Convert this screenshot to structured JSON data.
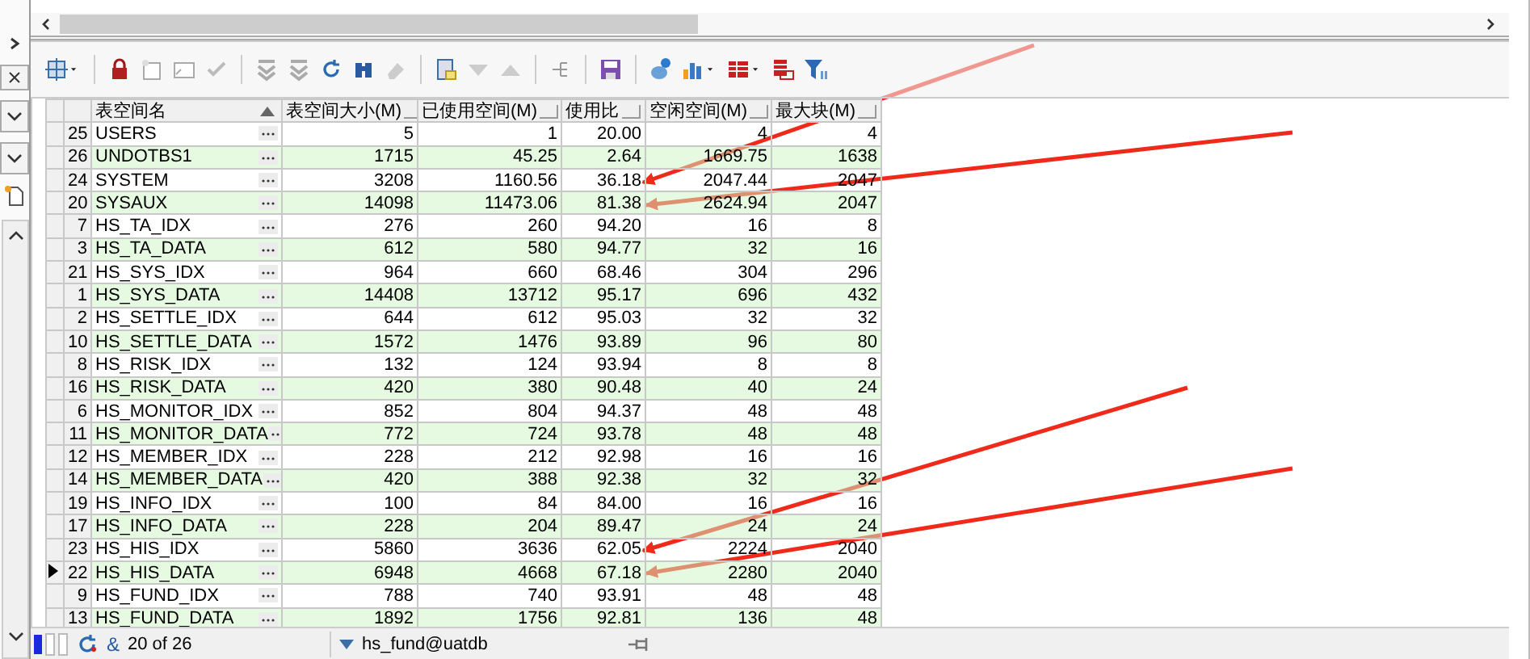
{
  "grid": {
    "columns": [
      {
        "label": "表空间名",
        "sorted": true
      },
      {
        "label": "表空间大小(M)",
        "sorted": false
      },
      {
        "label": "已使用空间(M)",
        "sorted": false
      },
      {
        "label": "使用比",
        "sorted": false
      },
      {
        "label": "空闲空间(M)",
        "sorted": false
      },
      {
        "label": "最大块(M)",
        "sorted": false
      }
    ],
    "rows": [
      {
        "num": "25",
        "cells": [
          "USERS",
          "5",
          "1",
          "20.00",
          "4",
          "4"
        ],
        "selected": false
      },
      {
        "num": "26",
        "cells": [
          "UNDOTBS1",
          "1715",
          "45.25",
          "2.64",
          "1669.75",
          "1638"
        ],
        "selected": false
      },
      {
        "num": "24",
        "cells": [
          "SYSTEM",
          "3208",
          "1160.56",
          "36.18",
          "2047.44",
          "2047"
        ],
        "selected": false
      },
      {
        "num": "20",
        "cells": [
          "SYSAUX",
          "14098",
          "11473.06",
          "81.38",
          "2624.94",
          "2047"
        ],
        "selected": false
      },
      {
        "num": "7",
        "cells": [
          "HS_TA_IDX",
          "276",
          "260",
          "94.20",
          "16",
          "8"
        ],
        "selected": false
      },
      {
        "num": "3",
        "cells": [
          "HS_TA_DATA",
          "612",
          "580",
          "94.77",
          "32",
          "16"
        ],
        "selected": false
      },
      {
        "num": "21",
        "cells": [
          "HS_SYS_IDX",
          "964",
          "660",
          "68.46",
          "304",
          "296"
        ],
        "selected": false
      },
      {
        "num": "1",
        "cells": [
          "HS_SYS_DATA",
          "14408",
          "13712",
          "95.17",
          "696",
          "432"
        ],
        "selected": false
      },
      {
        "num": "2",
        "cells": [
          "HS_SETTLE_IDX",
          "644",
          "612",
          "95.03",
          "32",
          "32"
        ],
        "selected": false
      },
      {
        "num": "10",
        "cells": [
          "HS_SETTLE_DATA",
          "1572",
          "1476",
          "93.89",
          "96",
          "80"
        ],
        "selected": false
      },
      {
        "num": "8",
        "cells": [
          "HS_RISK_IDX",
          "132",
          "124",
          "93.94",
          "8",
          "8"
        ],
        "selected": false
      },
      {
        "num": "16",
        "cells": [
          "HS_RISK_DATA",
          "420",
          "380",
          "90.48",
          "40",
          "24"
        ],
        "selected": false
      },
      {
        "num": "6",
        "cells": [
          "HS_MONITOR_IDX",
          "852",
          "804",
          "94.37",
          "48",
          "48"
        ],
        "selected": false
      },
      {
        "num": "11",
        "cells": [
          "HS_MONITOR_DATA",
          "772",
          "724",
          "93.78",
          "48",
          "48"
        ],
        "selected": false
      },
      {
        "num": "12",
        "cells": [
          "HS_MEMBER_IDX",
          "228",
          "212",
          "92.98",
          "16",
          "16"
        ],
        "selected": false
      },
      {
        "num": "14",
        "cells": [
          "HS_MEMBER_DATA",
          "420",
          "388",
          "92.38",
          "32",
          "32"
        ],
        "selected": false
      },
      {
        "num": "19",
        "cells": [
          "HS_INFO_IDX",
          "100",
          "84",
          "84.00",
          "16",
          "16"
        ],
        "selected": false
      },
      {
        "num": "17",
        "cells": [
          "HS_INFO_DATA",
          "228",
          "204",
          "89.47",
          "24",
          "24"
        ],
        "selected": false
      },
      {
        "num": "23",
        "cells": [
          "HS_HIS_IDX",
          "5860",
          "3636",
          "62.05",
          "2224",
          "2040"
        ],
        "selected": false
      },
      {
        "num": "22",
        "cells": [
          "HS_HIS_DATA",
          "6948",
          "4668",
          "67.18",
          "2280",
          "2040"
        ],
        "selected": true
      },
      {
        "num": "9",
        "cells": [
          "HS_FUND_IDX",
          "788",
          "740",
          "93.91",
          "48",
          "48"
        ],
        "selected": false
      },
      {
        "num": "13",
        "cells": [
          "HS_FUND_DATA",
          "1892",
          "1756",
          "92.81",
          "136",
          "48"
        ],
        "selected": false
      }
    ]
  },
  "status_bar": {
    "ampersand": "&",
    "record": "20 of 26",
    "connection": "hs_fund@uatdb"
  }
}
